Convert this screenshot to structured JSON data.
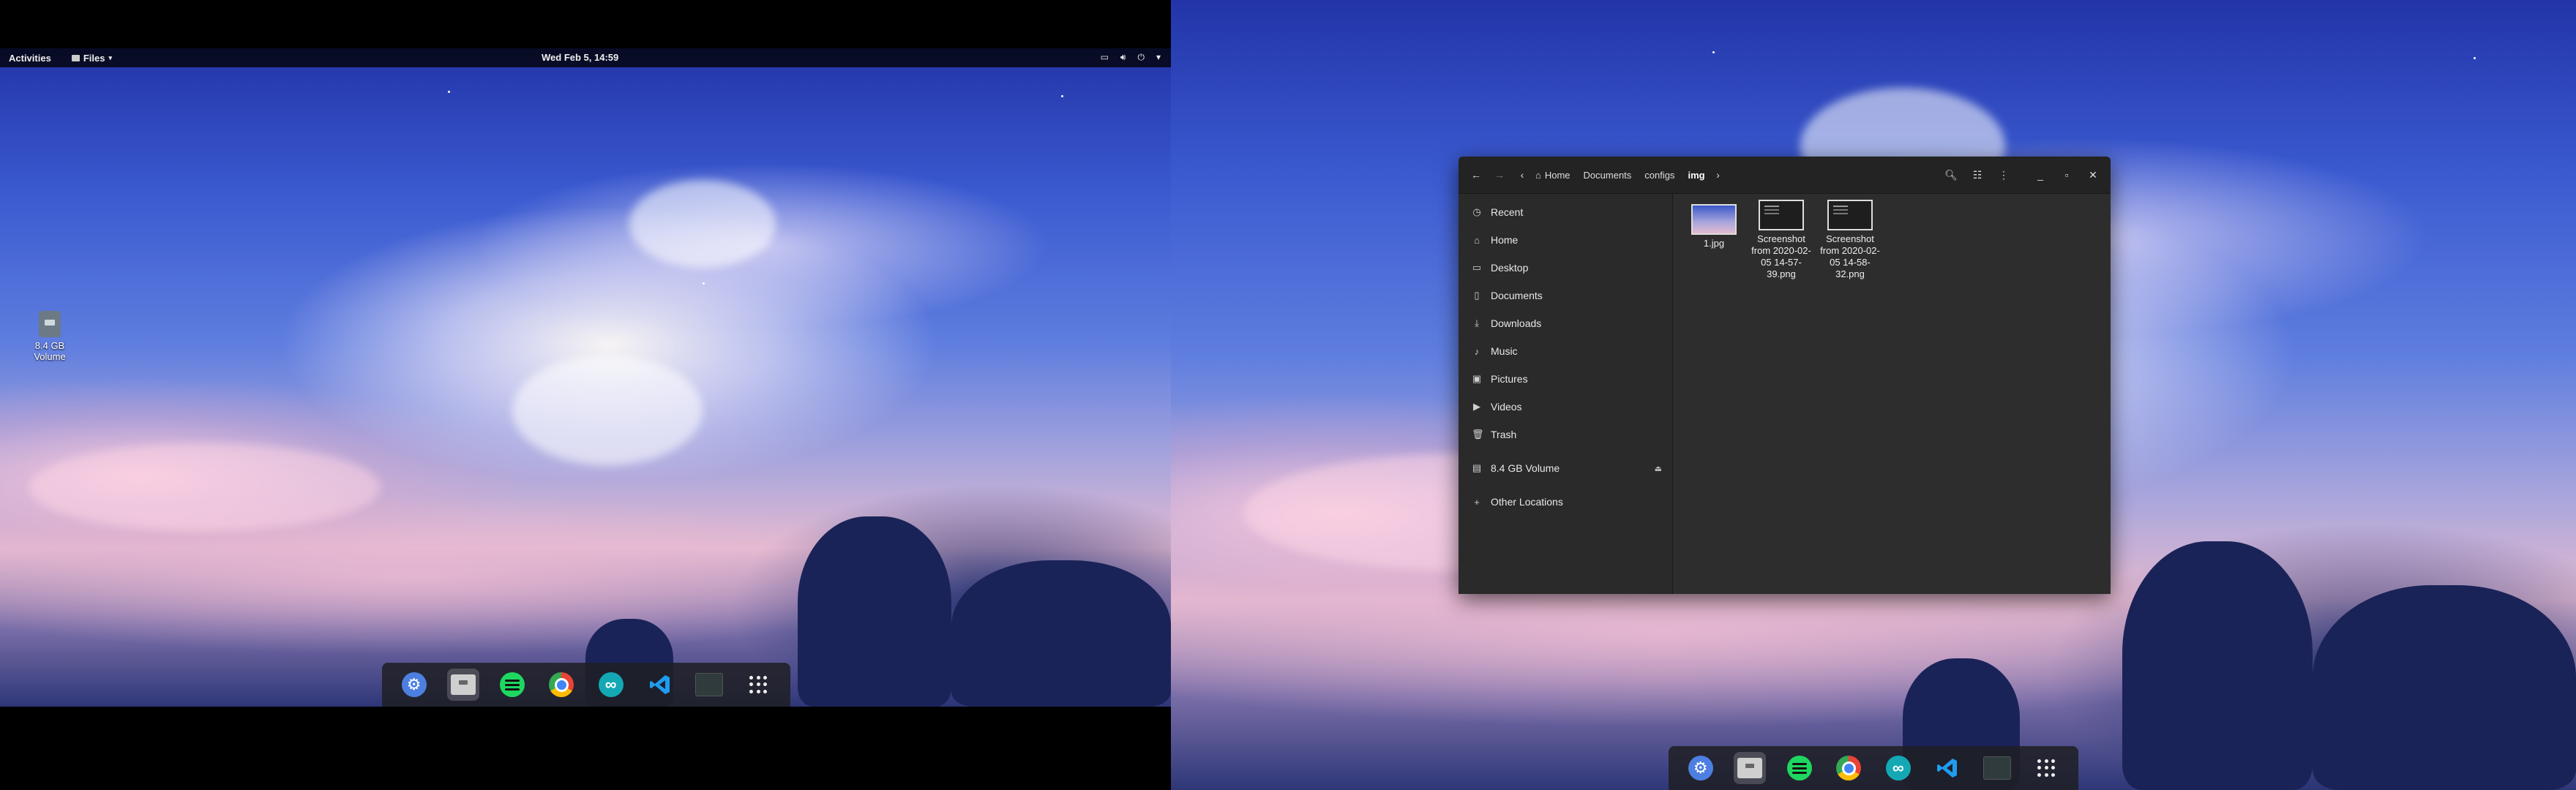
{
  "left_screen": {
    "topbar": {
      "activities": "Activities",
      "app_menu": "Files",
      "clock": "Wed Feb  5, 14:59"
    },
    "desktop_icon": {
      "label": "8.4 GB Volume"
    },
    "dock": {
      "apps": [
        {
          "name": "settings-icon"
        },
        {
          "name": "files-icon"
        },
        {
          "name": "spotify-icon"
        },
        {
          "name": "chrome-icon"
        },
        {
          "name": "arduino-icon"
        },
        {
          "name": "vscode-icon"
        },
        {
          "name": "terminal-icon"
        },
        {
          "name": "show-apps-icon"
        }
      ]
    }
  },
  "files_window": {
    "breadcrumbs": [
      "Home",
      "Documents",
      "configs",
      "img"
    ],
    "sidebar": {
      "items": [
        {
          "label": "Recent",
          "icon": "clock-icon"
        },
        {
          "label": "Home",
          "icon": "home-icon"
        },
        {
          "label": "Desktop",
          "icon": "desktop-icon"
        },
        {
          "label": "Documents",
          "icon": "document-icon"
        },
        {
          "label": "Downloads",
          "icon": "download-icon"
        },
        {
          "label": "Music",
          "icon": "music-icon"
        },
        {
          "label": "Pictures",
          "icon": "picture-icon"
        },
        {
          "label": "Videos",
          "icon": "video-icon"
        },
        {
          "label": "Trash",
          "icon": "trash-icon"
        }
      ],
      "volume": "8.4 GB Volume",
      "other_locations": "Other Locations"
    },
    "files": [
      {
        "name": "1.jpg",
        "kind": "image"
      },
      {
        "name": "Screenshot from 2020-02-05 14-57-39.png",
        "kind": "screenshot"
      },
      {
        "name": "Screenshot from 2020-02-05 14-58-32.png",
        "kind": "screenshot"
      }
    ]
  }
}
